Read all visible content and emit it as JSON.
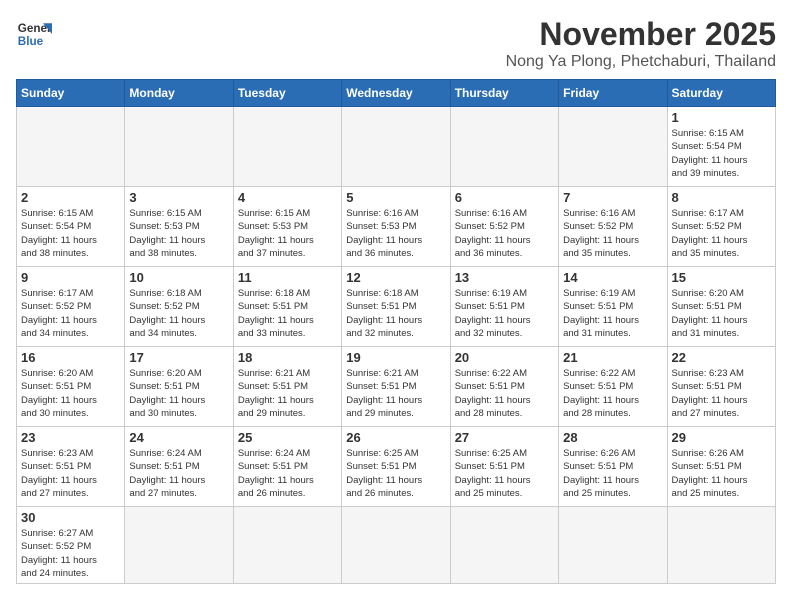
{
  "header": {
    "logo_line1": "General",
    "logo_line2": "Blue",
    "title": "November 2025",
    "subtitle": "Nong Ya Plong, Phetchaburi, Thailand"
  },
  "weekdays": [
    "Sunday",
    "Monday",
    "Tuesday",
    "Wednesday",
    "Thursday",
    "Friday",
    "Saturday"
  ],
  "weeks": [
    [
      {
        "day": "",
        "info": ""
      },
      {
        "day": "",
        "info": ""
      },
      {
        "day": "",
        "info": ""
      },
      {
        "day": "",
        "info": ""
      },
      {
        "day": "",
        "info": ""
      },
      {
        "day": "",
        "info": ""
      },
      {
        "day": "1",
        "info": "Sunrise: 6:15 AM\nSunset: 5:54 PM\nDaylight: 11 hours\nand 39 minutes."
      }
    ],
    [
      {
        "day": "2",
        "info": "Sunrise: 6:15 AM\nSunset: 5:54 PM\nDaylight: 11 hours\nand 38 minutes."
      },
      {
        "day": "3",
        "info": "Sunrise: 6:15 AM\nSunset: 5:53 PM\nDaylight: 11 hours\nand 38 minutes."
      },
      {
        "day": "4",
        "info": "Sunrise: 6:15 AM\nSunset: 5:53 PM\nDaylight: 11 hours\nand 37 minutes."
      },
      {
        "day": "5",
        "info": "Sunrise: 6:16 AM\nSunset: 5:53 PM\nDaylight: 11 hours\nand 36 minutes."
      },
      {
        "day": "6",
        "info": "Sunrise: 6:16 AM\nSunset: 5:52 PM\nDaylight: 11 hours\nand 36 minutes."
      },
      {
        "day": "7",
        "info": "Sunrise: 6:16 AM\nSunset: 5:52 PM\nDaylight: 11 hours\nand 35 minutes."
      },
      {
        "day": "8",
        "info": "Sunrise: 6:17 AM\nSunset: 5:52 PM\nDaylight: 11 hours\nand 35 minutes."
      }
    ],
    [
      {
        "day": "9",
        "info": "Sunrise: 6:17 AM\nSunset: 5:52 PM\nDaylight: 11 hours\nand 34 minutes."
      },
      {
        "day": "10",
        "info": "Sunrise: 6:18 AM\nSunset: 5:52 PM\nDaylight: 11 hours\nand 34 minutes."
      },
      {
        "day": "11",
        "info": "Sunrise: 6:18 AM\nSunset: 5:51 PM\nDaylight: 11 hours\nand 33 minutes."
      },
      {
        "day": "12",
        "info": "Sunrise: 6:18 AM\nSunset: 5:51 PM\nDaylight: 11 hours\nand 32 minutes."
      },
      {
        "day": "13",
        "info": "Sunrise: 6:19 AM\nSunset: 5:51 PM\nDaylight: 11 hours\nand 32 minutes."
      },
      {
        "day": "14",
        "info": "Sunrise: 6:19 AM\nSunset: 5:51 PM\nDaylight: 11 hours\nand 31 minutes."
      },
      {
        "day": "15",
        "info": "Sunrise: 6:20 AM\nSunset: 5:51 PM\nDaylight: 11 hours\nand 31 minutes."
      }
    ],
    [
      {
        "day": "16",
        "info": "Sunrise: 6:20 AM\nSunset: 5:51 PM\nDaylight: 11 hours\nand 30 minutes."
      },
      {
        "day": "17",
        "info": "Sunrise: 6:20 AM\nSunset: 5:51 PM\nDaylight: 11 hours\nand 30 minutes."
      },
      {
        "day": "18",
        "info": "Sunrise: 6:21 AM\nSunset: 5:51 PM\nDaylight: 11 hours\nand 29 minutes."
      },
      {
        "day": "19",
        "info": "Sunrise: 6:21 AM\nSunset: 5:51 PM\nDaylight: 11 hours\nand 29 minutes."
      },
      {
        "day": "20",
        "info": "Sunrise: 6:22 AM\nSunset: 5:51 PM\nDaylight: 11 hours\nand 28 minutes."
      },
      {
        "day": "21",
        "info": "Sunrise: 6:22 AM\nSunset: 5:51 PM\nDaylight: 11 hours\nand 28 minutes."
      },
      {
        "day": "22",
        "info": "Sunrise: 6:23 AM\nSunset: 5:51 PM\nDaylight: 11 hours\nand 27 minutes."
      }
    ],
    [
      {
        "day": "23",
        "info": "Sunrise: 6:23 AM\nSunset: 5:51 PM\nDaylight: 11 hours\nand 27 minutes."
      },
      {
        "day": "24",
        "info": "Sunrise: 6:24 AM\nSunset: 5:51 PM\nDaylight: 11 hours\nand 27 minutes."
      },
      {
        "day": "25",
        "info": "Sunrise: 6:24 AM\nSunset: 5:51 PM\nDaylight: 11 hours\nand 26 minutes."
      },
      {
        "day": "26",
        "info": "Sunrise: 6:25 AM\nSunset: 5:51 PM\nDaylight: 11 hours\nand 26 minutes."
      },
      {
        "day": "27",
        "info": "Sunrise: 6:25 AM\nSunset: 5:51 PM\nDaylight: 11 hours\nand 25 minutes."
      },
      {
        "day": "28",
        "info": "Sunrise: 6:26 AM\nSunset: 5:51 PM\nDaylight: 11 hours\nand 25 minutes."
      },
      {
        "day": "29",
        "info": "Sunrise: 6:26 AM\nSunset: 5:51 PM\nDaylight: 11 hours\nand 25 minutes."
      }
    ],
    [
      {
        "day": "30",
        "info": "Sunrise: 6:27 AM\nSunset: 5:52 PM\nDaylight: 11 hours\nand 24 minutes."
      },
      {
        "day": "",
        "info": ""
      },
      {
        "day": "",
        "info": ""
      },
      {
        "day": "",
        "info": ""
      },
      {
        "day": "",
        "info": ""
      },
      {
        "day": "",
        "info": ""
      },
      {
        "day": "",
        "info": ""
      }
    ]
  ]
}
